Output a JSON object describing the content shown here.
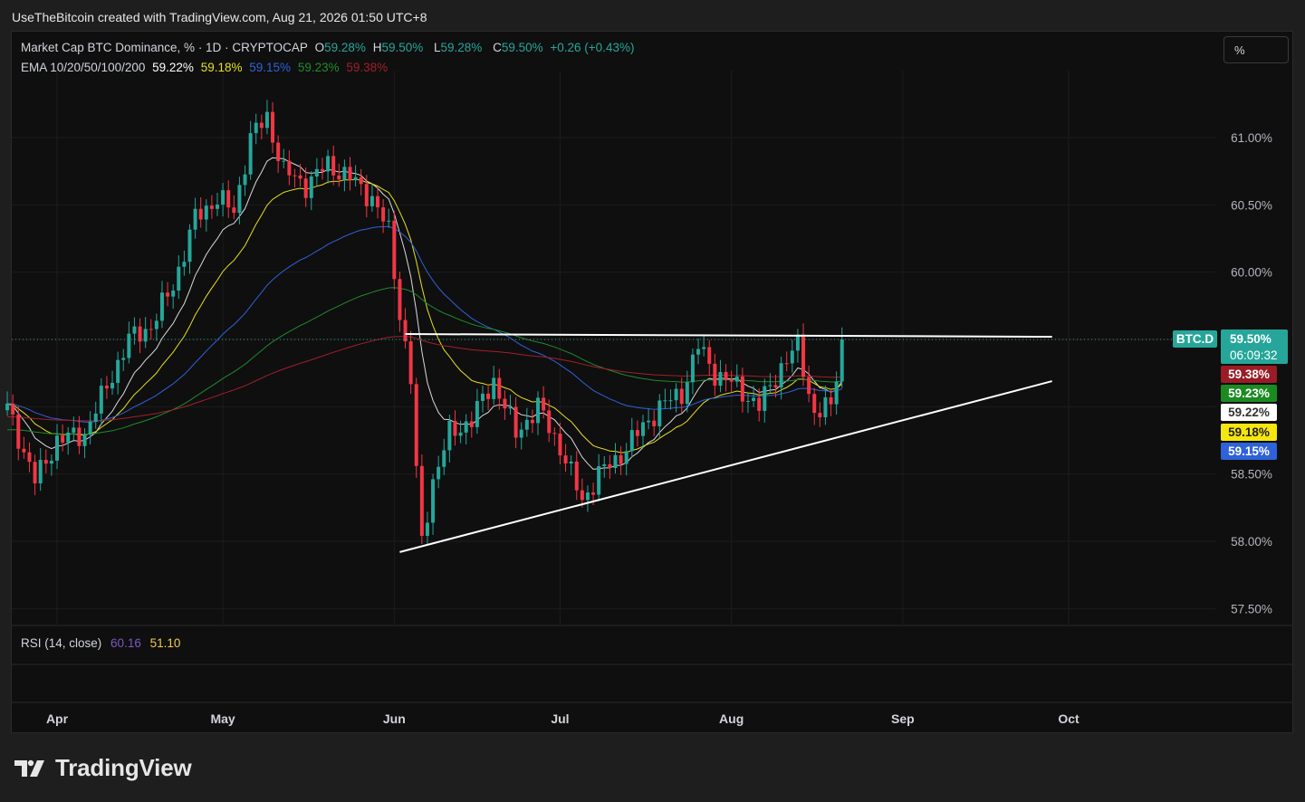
{
  "header": {
    "attribution": "UseTheBitcoin created with TradingView.com, Aug 21, 2026 01:50 UTC+8"
  },
  "legend": {
    "symbol": "Market Cap BTC Dominance, % · 1D · CRYPTOCAP",
    "o_label": "O",
    "o_value": "59.28%",
    "h_label": "H",
    "h_value": "59.50%",
    "l_label": "L",
    "l_value": "59.28%",
    "c_label": "C",
    "c_value": "59.50%",
    "change": "+0.26 (+0.43%)",
    "ema_label": "EMA 10/20/50/100/200",
    "ema10": "59.22%",
    "ema20": "59.18%",
    "ema50": "59.15%",
    "ema100": "59.23%",
    "ema200": "59.38%"
  },
  "rsi": {
    "label": "RSI (14, close)",
    "value": "60.16",
    "ma_value": "51.10"
  },
  "scale_button": "%",
  "price_labels": {
    "symbol_tag": "BTC.D",
    "last": "59.50%",
    "countdown": "06:09:32",
    "ema200": "59.38%",
    "ema100": "59.23%",
    "ema10": "59.22%",
    "ema20": "59.18%",
    "ema50": "59.15%"
  },
  "brand": "TradingView",
  "colors": {
    "up": "#26a69a",
    "down": "#f23645",
    "ema10": "#d9d9d9",
    "ema20": "#e7e01f",
    "ema50": "#2e62d9",
    "ema100": "#1f8a2d",
    "ema200": "#a31f2a",
    "trendline": "#ffffff",
    "rsi": "#7e57c2",
    "rsi_ma": "#f2c94c"
  },
  "chart_data": {
    "type": "candlestick",
    "y_axis": {
      "unit": "%",
      "ticks": [
        "61.00%",
        "60.50%",
        "60.00%",
        "58.50%",
        "58.00%",
        "57.50%"
      ],
      "tick_values": [
        61.0,
        60.5,
        60.0,
        58.5,
        58.0,
        57.5
      ]
    },
    "x_axis": {
      "ticks": [
        "Apr",
        "May",
        "Jun",
        "Jul",
        "Aug",
        "Sep",
        "Oct"
      ]
    },
    "range": {
      "first": "2026-03-23",
      "last": "2026-08-21",
      "price_min": 57.9,
      "price_max": 61.2
    },
    "anchors": [
      {
        "date": "2026-03-23",
        "close": 59.0
      },
      {
        "date": "2026-03-28",
        "close": 58.45
      },
      {
        "date": "2026-04-01",
        "close": 58.75
      },
      {
        "date": "2026-04-06",
        "close": 58.8
      },
      {
        "date": "2026-04-10",
        "close": 59.15
      },
      {
        "date": "2026-04-14",
        "close": 59.5
      },
      {
        "date": "2026-04-18",
        "close": 59.6
      },
      {
        "date": "2026-04-22",
        "close": 59.9
      },
      {
        "date": "2026-04-26",
        "close": 60.4
      },
      {
        "date": "2026-04-30",
        "close": 60.55
      },
      {
        "date": "2026-05-03",
        "close": 60.45
      },
      {
        "date": "2026-05-06",
        "close": 61.0
      },
      {
        "date": "2026-05-09",
        "close": 61.15
      },
      {
        "date": "2026-05-12",
        "close": 60.75
      },
      {
        "date": "2026-05-16",
        "close": 60.65
      },
      {
        "date": "2026-05-20",
        "close": 60.8
      },
      {
        "date": "2026-05-24",
        "close": 60.7
      },
      {
        "date": "2026-05-28",
        "close": 60.55
      },
      {
        "date": "2026-05-31",
        "close": 60.3
      },
      {
        "date": "2026-06-02",
        "close": 59.7
      },
      {
        "date": "2026-06-04",
        "close": 59.2
      },
      {
        "date": "2026-06-05",
        "close": 58.5
      },
      {
        "date": "2026-06-06",
        "close": 58.0
      },
      {
        "date": "2026-06-08",
        "close": 58.45
      },
      {
        "date": "2026-06-11",
        "close": 58.8
      },
      {
        "date": "2026-06-15",
        "close": 58.9
      },
      {
        "date": "2026-06-19",
        "close": 59.2
      },
      {
        "date": "2026-06-23",
        "close": 58.8
      },
      {
        "date": "2026-06-27",
        "close": 59.0
      },
      {
        "date": "2026-07-01",
        "close": 58.7
      },
      {
        "date": "2026-07-05",
        "close": 58.3
      },
      {
        "date": "2026-07-08",
        "close": 58.5
      },
      {
        "date": "2026-07-11",
        "close": 58.6
      },
      {
        "date": "2026-07-15",
        "close": 58.8
      },
      {
        "date": "2026-07-19",
        "close": 59.0
      },
      {
        "date": "2026-07-23",
        "close": 59.1
      },
      {
        "date": "2026-07-26",
        "close": 59.45
      },
      {
        "date": "2026-07-29",
        "close": 59.25
      },
      {
        "date": "2026-08-02",
        "close": 59.15
      },
      {
        "date": "2026-08-06",
        "close": 59.0
      },
      {
        "date": "2026-08-10",
        "close": 59.3
      },
      {
        "date": "2026-08-13",
        "close": 59.45
      },
      {
        "date": "2026-08-16",
        "close": 58.95
      },
      {
        "date": "2026-08-19",
        "close": 59.0
      },
      {
        "date": "2026-08-21",
        "close": 59.5
      }
    ],
    "ema_series": [
      {
        "name": "EMA 10",
        "last": 59.22
      },
      {
        "name": "EMA 20",
        "last": 59.18
      },
      {
        "name": "EMA 50",
        "last": 59.15
      },
      {
        "name": "EMA 100",
        "last": 59.23
      },
      {
        "name": "EMA 200",
        "last": 59.38
      }
    ],
    "trendlines": [
      {
        "kind": "resistance",
        "from": {
          "date": "2026-06-03",
          "value": 59.54
        },
        "to": {
          "date": "2026-09-28",
          "value": 59.52
        }
      },
      {
        "kind": "support",
        "from": {
          "date": "2026-06-02",
          "value": 57.92
        },
        "to": {
          "date": "2026-09-28",
          "value": 59.19
        }
      }
    ]
  }
}
